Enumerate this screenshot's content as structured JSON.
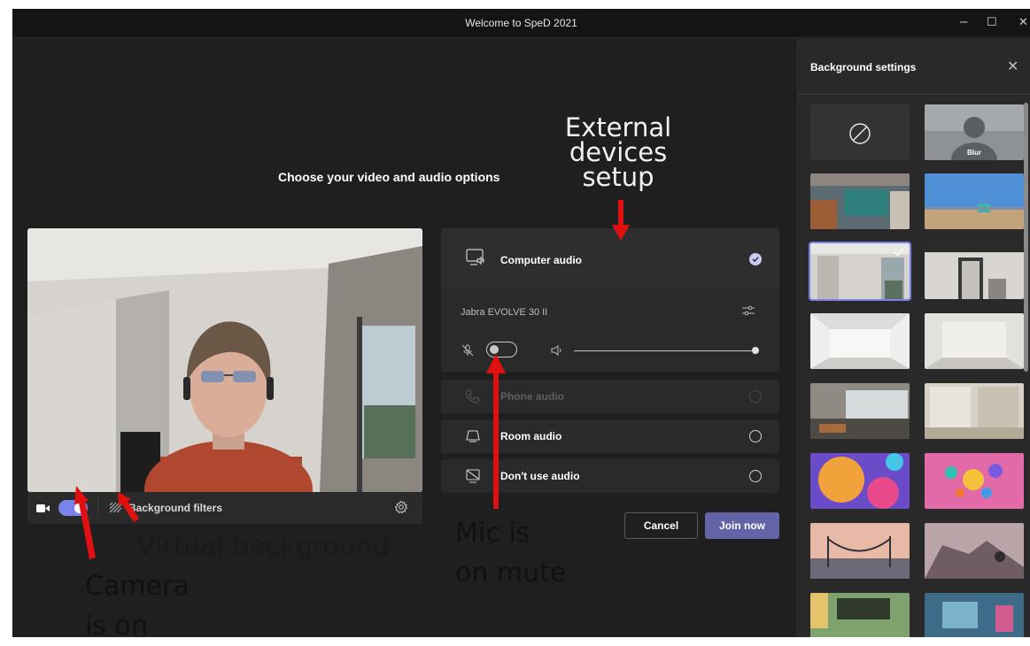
{
  "window": {
    "title": "Welcome to SpeD 2021",
    "minimize": "–",
    "maximize": "☐",
    "close": "✕"
  },
  "main": {
    "heading": "Choose your video and audio options"
  },
  "video_bar": {
    "camera_icon": "video-camera-icon",
    "camera_toggle": "on",
    "background_filters_label": "Background filters",
    "settings_icon": "gear-icon"
  },
  "audio": {
    "computer_audio_label": "Computer audio",
    "device_name": "Jabra EVOLVE 30 II",
    "mic_state": "muted",
    "options": [
      {
        "label": "Phone audio",
        "enabled": false
      },
      {
        "label": "Room audio",
        "enabled": true
      },
      {
        "label": "Don't use audio",
        "enabled": true
      }
    ]
  },
  "buttons": {
    "cancel": "Cancel",
    "join": "Join now"
  },
  "background_settings": {
    "title": "Background settings",
    "close": "✕",
    "blur_label": "Blur"
  },
  "annotations": {
    "external_devices_1": "External",
    "external_devices_2": "devices",
    "external_devices_3": "setup",
    "virtual_background": "Virtual background",
    "camera_1": "Camera",
    "camera_2": "is on",
    "mic_1": "Mic is",
    "mic_2": "on mute"
  },
  "colors": {
    "accent": "#6264a7",
    "toggle_on": "#7b83eb",
    "arrow": "#e01010"
  }
}
